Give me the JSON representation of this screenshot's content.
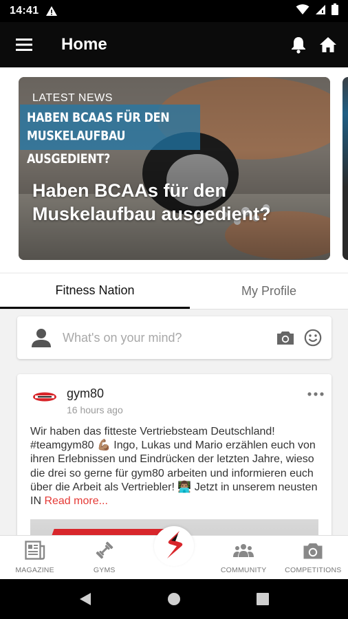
{
  "status_bar": {
    "time": "14:41"
  },
  "app_bar": {
    "title": "Home"
  },
  "featured": {
    "label": "LATEST NEWS",
    "banner_line1": "HABEN BCAAS FÜR DEN",
    "banner_line2": "MUSKELAUFBAU AUSGEDIENT?",
    "headline": "Haben BCAAs für den Muskelaufbau ausgedient?"
  },
  "tabs": [
    {
      "label": "Fitness Nation",
      "active": true
    },
    {
      "label": "My Profile",
      "active": false
    }
  ],
  "composer": {
    "placeholder": "What's on your mind?"
  },
  "post": {
    "author": "gym80",
    "time": "16 hours ago",
    "text": "Wir haben das fitteste Vertriebsteam Deutschland! #teamgym80 💪🏽 Ingo, Lukas und Mario erzählen euch von ihren Erlebnissen und Eindrücken der letzten Jahre, wieso die drei so gerne für gym80 arbeiten und informieren euch über die Arbeit als Vertriebler! 👨🏽‍💻 Jetzt in unserem neusten IN ",
    "read_more": "Read more..."
  },
  "bottom_nav": [
    {
      "label": "MAGAZINE",
      "icon": "newspaper-icon"
    },
    {
      "label": "GYMS",
      "icon": "dumbbell-icon"
    },
    {
      "label": "",
      "icon": "gym80-logo-icon"
    },
    {
      "label": "COMMUNITY",
      "icon": "people-icon"
    },
    {
      "label": "COMPETITIONS",
      "icon": "camera-icon"
    }
  ],
  "colors": {
    "accent_red": "#e53935",
    "app_bar": "#0b0b0b",
    "banner_blue": "#2078aa"
  }
}
